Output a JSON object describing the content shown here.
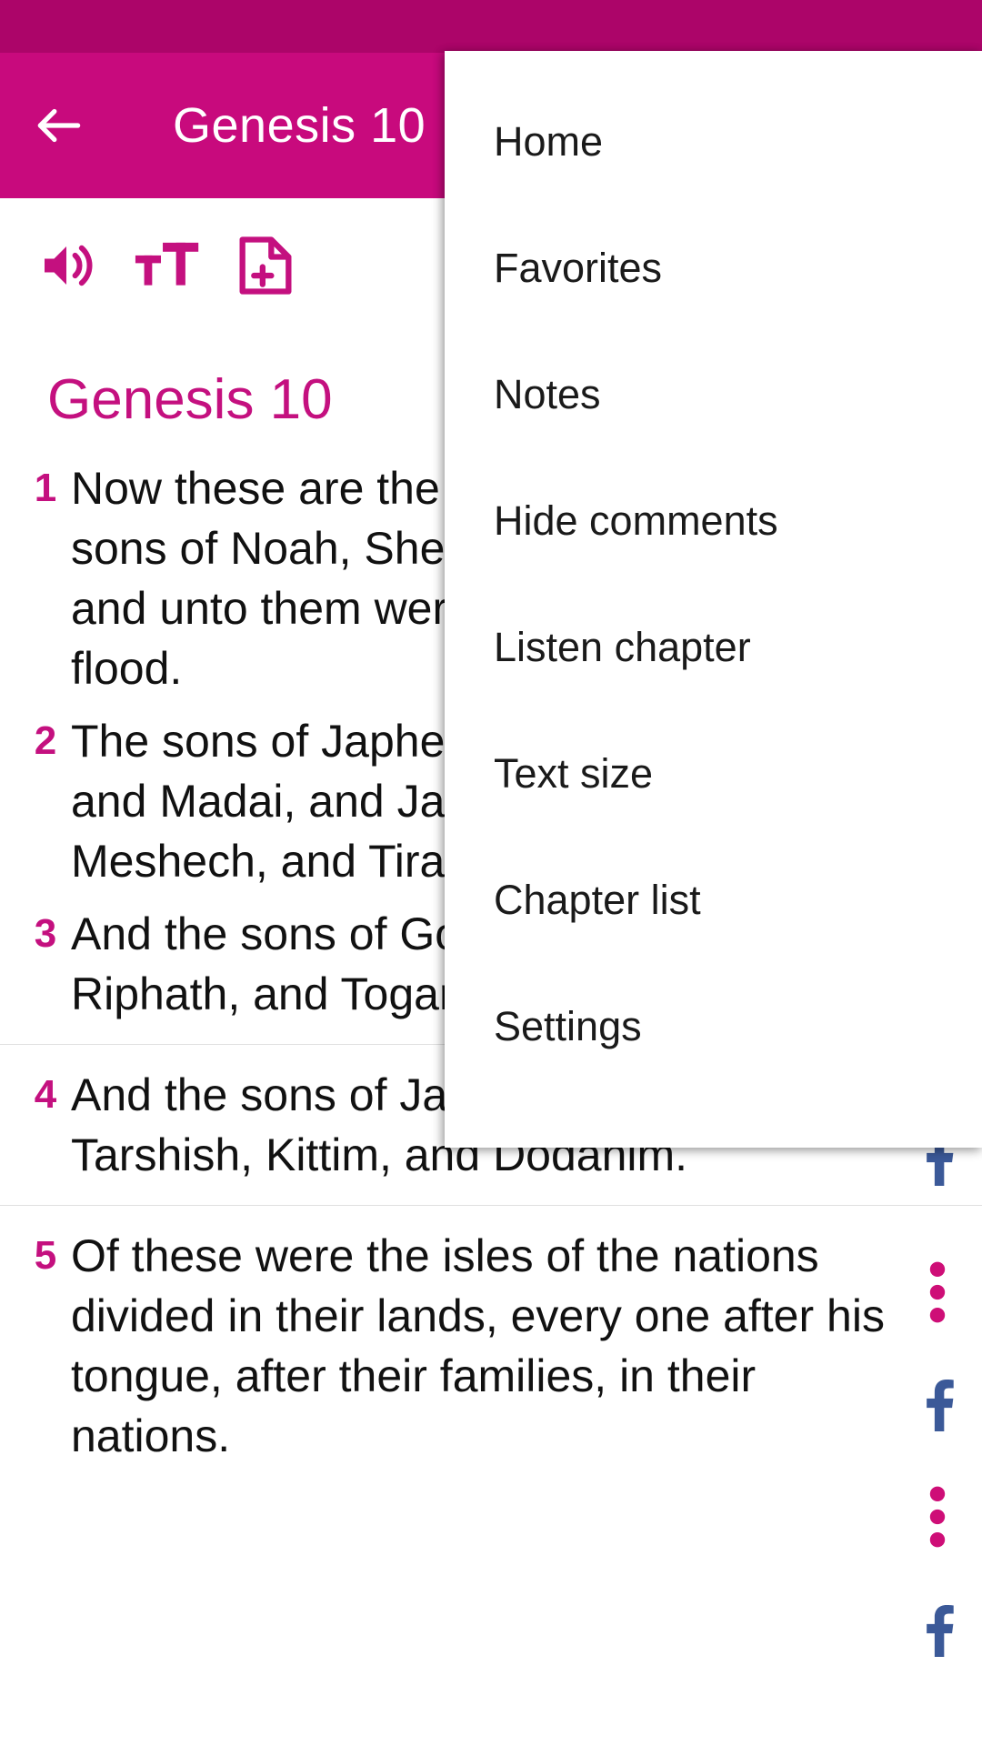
{
  "status_bar": {
    "color": "#AC0569"
  },
  "app_bar": {
    "color": "#C80A7D",
    "back_icon": "arrow-left-icon",
    "title": "Genesis 10"
  },
  "toolbar": {
    "icons": [
      {
        "name": "volume-speaker-icon",
        "label": "Listen"
      },
      {
        "name": "text-size-icon",
        "label": "Text size"
      },
      {
        "name": "add-note-document-icon",
        "label": "Add note"
      }
    ],
    "color": "#C4107F"
  },
  "content": {
    "chapter_heading": "Genesis 10",
    "accent_color": "#C4107F",
    "verses": [
      {
        "number": "1",
        "text": "Now these are the generations of the sons of Noah, Shem, Ham, and Japheth: and unto them were sons born after the flood."
      },
      {
        "number": "2",
        "text": "The sons of Japheth; Gomer, and Magog, and Madai, and Javan, and Tubal, and Meshech, and Tiras."
      },
      {
        "number": "3",
        "text": "And the sons of Gomer; Ashkenaz, and Riphath, and Togarmah."
      },
      {
        "number": "4",
        "text": "And the sons of Javan: Elishah, and Tarshish, Kittim, and Dodanim."
      },
      {
        "number": "5",
        "text": "Of these were the isles of the nations divided in their lands, every one after his tongue, after their families, in their nations."
      }
    ]
  },
  "rail": {
    "facebook_color": "#3B5998",
    "overflow_color": "#CE0E77",
    "items": [
      {
        "name": "facebook-share-icon"
      },
      {
        "name": "verse-overflow-menu-icon"
      },
      {
        "name": "facebook-share-icon"
      },
      {
        "name": "verse-overflow-menu-icon"
      },
      {
        "name": "facebook-share-icon"
      }
    ]
  },
  "menu": {
    "items": [
      {
        "label": "Home"
      },
      {
        "label": "Favorites"
      },
      {
        "label": "Notes"
      },
      {
        "label": "Hide comments"
      },
      {
        "label": "Listen chapter"
      },
      {
        "label": "Text size"
      },
      {
        "label": "Chapter list"
      },
      {
        "label": "Settings"
      }
    ]
  }
}
